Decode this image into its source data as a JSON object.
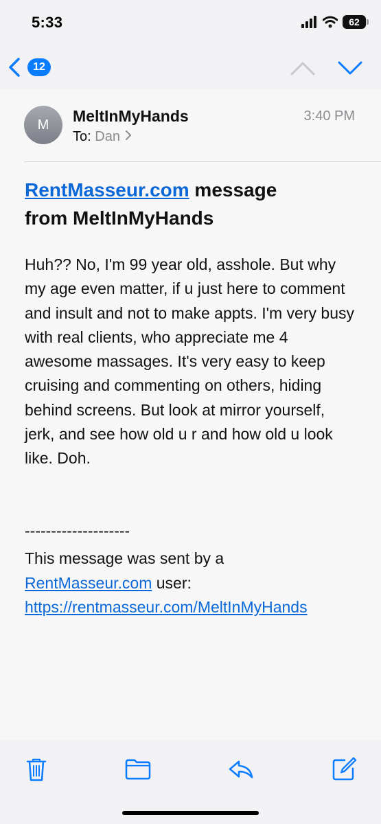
{
  "status_bar": {
    "time": "5:33",
    "battery": "62"
  },
  "nav": {
    "unread_count": "12"
  },
  "email": {
    "avatar_initial": "M",
    "sender": "MeltInMyHands",
    "to_label": "To:",
    "recipient": "Dan",
    "time": "3:40 PM",
    "subject_link": "RentMasseur.com",
    "subject_rest_line1": " message",
    "subject_line2": "from MeltInMyHands",
    "body": "Huh?? No, I'm 99 year old, asshole. But why my age even matter, if u just here to comment and insult and not to make appts. I'm very busy with real clients, who appreciate me 4 awesome massages. It's very easy to keep cruising and commenting on others, hiding behind screens. But look at mirror yourself, jerk, and see how old u r and how old u look like. Doh.",
    "separator": "--------------------",
    "footer_prefix": "This message was sent by a",
    "footer_link": "RentMasseur.com",
    "footer_suffix": " user:",
    "profile_url": "https://rentmasseur.com/MeltInMyHands"
  },
  "toolbar": {
    "icons": [
      "trash-icon",
      "folder-icon",
      "reply-icon",
      "compose-icon"
    ]
  },
  "colors": {
    "accent": "#0a7cff",
    "link": "#0a68d8",
    "secondary_text": "#8b8b90",
    "background": "#f2f2f4"
  }
}
